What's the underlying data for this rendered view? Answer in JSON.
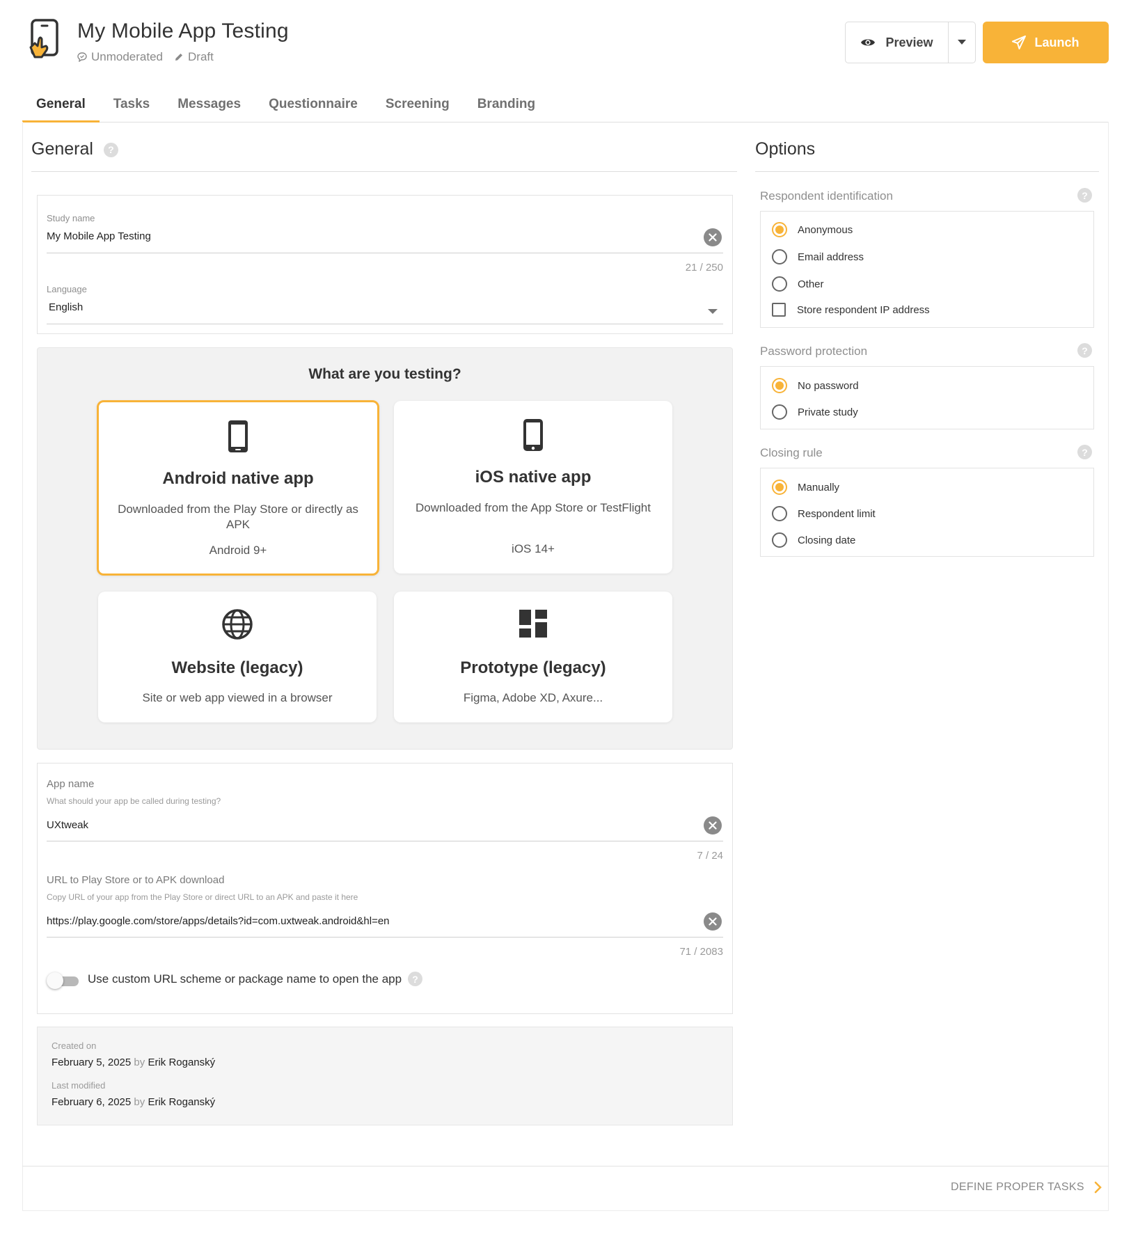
{
  "header": {
    "title": "My Mobile App Testing",
    "mode": "Unmoderated",
    "status": "Draft",
    "preview_label": "Preview",
    "launch_label": "Launch",
    "accent_color": "#f8b338"
  },
  "tabs": [
    {
      "label": "General",
      "active": true
    },
    {
      "label": "Tasks"
    },
    {
      "label": "Messages"
    },
    {
      "label": "Questionnaire"
    },
    {
      "label": "Screening"
    },
    {
      "label": "Branding"
    }
  ],
  "general": {
    "heading": "General",
    "study_name": {
      "label": "Study name",
      "value": "My Mobile App Testing",
      "count": "21 / 250"
    },
    "language": {
      "label": "Language",
      "value": "English"
    },
    "testing": {
      "title": "What are you testing?",
      "options": [
        {
          "title": "Android native app",
          "desc": "Downloaded from the Play Store or directly as APK",
          "req": "Android 9+",
          "icon": "smartphone-icon",
          "selected": true
        },
        {
          "title": "iOS native app",
          "desc": "Downloaded from the App Store or TestFlight",
          "req": "iOS 14+",
          "icon": "iphone-icon"
        },
        {
          "title": "Website (legacy)",
          "desc": "Site or web app viewed in a browser",
          "icon": "globe-icon"
        },
        {
          "title": "Prototype (legacy)",
          "desc": "Figma, Adobe XD, Axure...",
          "icon": "dashboard-icon"
        }
      ]
    },
    "app_name": {
      "label": "App name",
      "hint": "What should your app be called during testing?",
      "value": "UXtweak",
      "count": "7 / 24"
    },
    "url": {
      "label": "URL to Play Store or to APK download",
      "hint": "Copy URL of your app from the Play Store or direct URL to an APK and paste it here",
      "value": "https://play.google.com/store/apps/details?id=com.uxtweak.android&hl=en",
      "count": "71 / 2083"
    },
    "custom_scheme": {
      "label": "Use custom URL scheme or package name to open the app",
      "enabled": false
    },
    "created": {
      "label": "Created on",
      "date": "February 5, 2025",
      "by": "by",
      "author": "Erik Roganský"
    },
    "modified": {
      "label": "Last modified",
      "date": "February 6, 2025",
      "by": "by",
      "author": "Erik Roganský"
    }
  },
  "options": {
    "heading": "Options",
    "respondent_identification": {
      "label": "Respondent identification",
      "choices": [
        "Anonymous",
        "Email address",
        "Other"
      ],
      "selected": "Anonymous",
      "store_ip_label": "Store respondent IP address",
      "store_ip": false
    },
    "password_protection": {
      "label": "Password protection",
      "choices": [
        "No password",
        "Private study"
      ],
      "selected": "No password"
    },
    "closing_rule": {
      "label": "Closing rule",
      "choices": [
        "Manually",
        "Respondent limit",
        "Closing date"
      ],
      "selected": "Manually"
    }
  },
  "footer": {
    "next_label": "DEFINE PROPER TASKS"
  }
}
